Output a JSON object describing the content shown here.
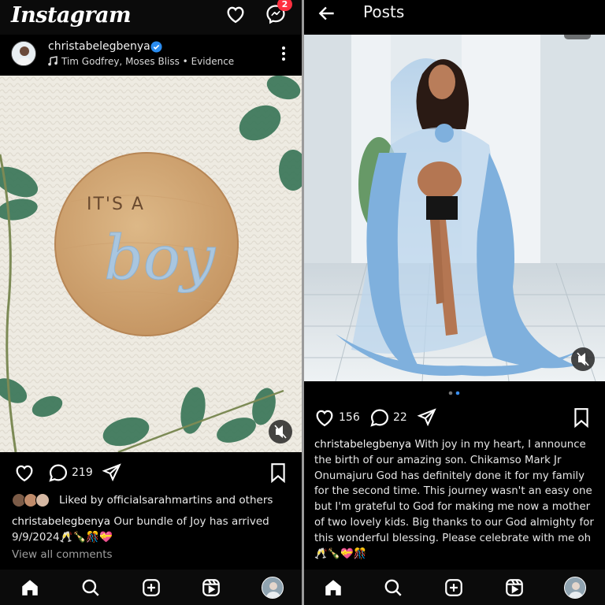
{
  "left": {
    "app_title": "Instagram",
    "notification_count": "2",
    "post": {
      "username": "christabelegbenya",
      "music": "Tim Godfrey, Moses Bliss • Evidence",
      "image_text_top": "IT'S A",
      "image_text_main": "boy",
      "comments_count": "219",
      "liked_by": "Liked by officialsarahmartins and others",
      "caption_user": "christabelegbenya",
      "caption_text": "Our bundle of Joy has arrived 9/9/2024🥂🍾🎊💝",
      "view_all_comments": "View all comments"
    }
  },
  "right": {
    "title": "Posts",
    "post": {
      "likes_count": "156",
      "comments_count": "22",
      "caption_user": "christabelegbenya",
      "caption_text": "With joy in my heart, I announce the birth of our amazing son. Chikamso Mark Jr Onumajuru God has definitely done it for my family for the second time. This journey wasn't an easy one but I'm grateful to God for making me now a mother of two  lovely kids. Big thanks to our God almighty for this wonderful blessing. Please celebrate with me oh 🥂🍾💝🎊"
    }
  },
  "colors": {
    "background": "#000000",
    "badge": "#ff3040",
    "verified": "#2a8cf0",
    "text": "#f5f5f5",
    "muted": "#9f9f9f"
  },
  "icons": [
    "heart-icon",
    "messenger-icon",
    "music-note-icon",
    "more-icon",
    "comment-icon",
    "share-icon",
    "bookmark-icon",
    "home-icon",
    "search-icon",
    "create-icon",
    "reels-icon",
    "profile-avatar-icon",
    "back-arrow-icon",
    "mute-icon"
  ]
}
